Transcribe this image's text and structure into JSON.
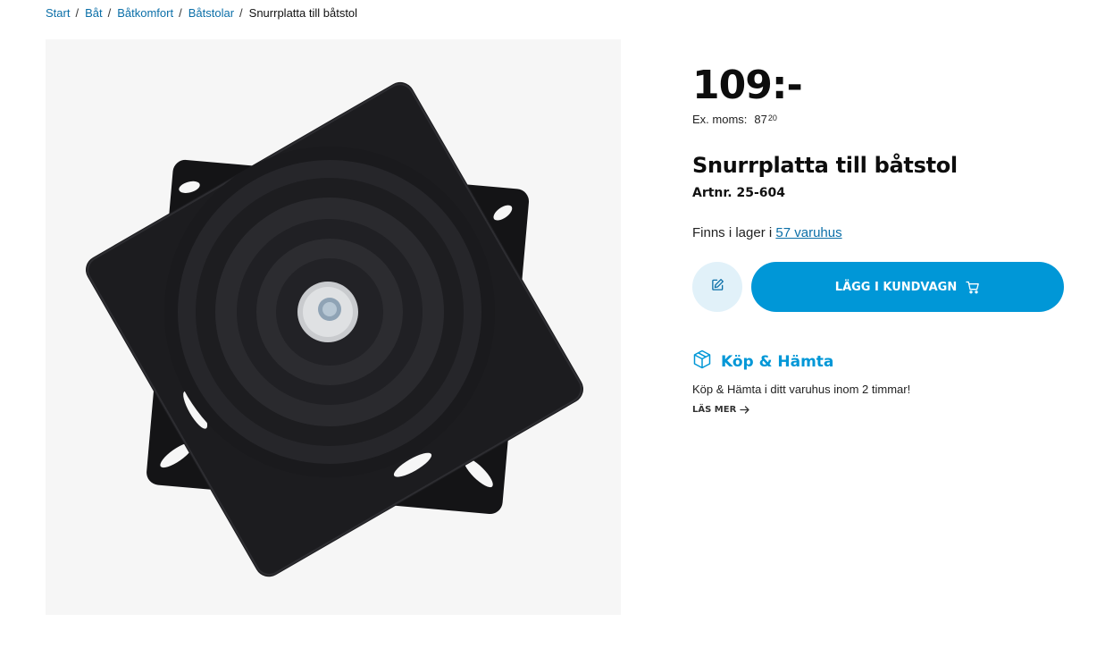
{
  "breadcrumb": {
    "items": [
      "Start",
      "Båt",
      "Båtkomfort",
      "Båtstolar"
    ],
    "current": "Snurrplatta till båtstol",
    "separator": "/"
  },
  "product": {
    "price": "109:-",
    "exvat_label": "Ex. moms:",
    "exvat_main": "87",
    "exvat_cents": "20",
    "title": "Snurrplatta till båtstol",
    "artnr": "Artnr. 25-604",
    "image_icon": "swivel-plate-image"
  },
  "stock": {
    "prefix": "Finns i lager i",
    "link": "57 varuhus"
  },
  "actions": {
    "note_icon": "edit-icon",
    "cart_label": "LÄGG I KUNDVAGN",
    "cart_icon": "cart-icon"
  },
  "click_collect": {
    "icon": "box-icon",
    "title": "Köp & Hämta",
    "description": "Köp & Hämta i ditt varuhus inom 2 timmar!",
    "more_label": "LÄS MER",
    "more_icon": "arrow-right-icon"
  },
  "colors": {
    "accent": "#0097d7",
    "link": "#0b6fa8",
    "note_button_bg": "#e1f1f9",
    "image_bg": "#f6f6f6"
  }
}
